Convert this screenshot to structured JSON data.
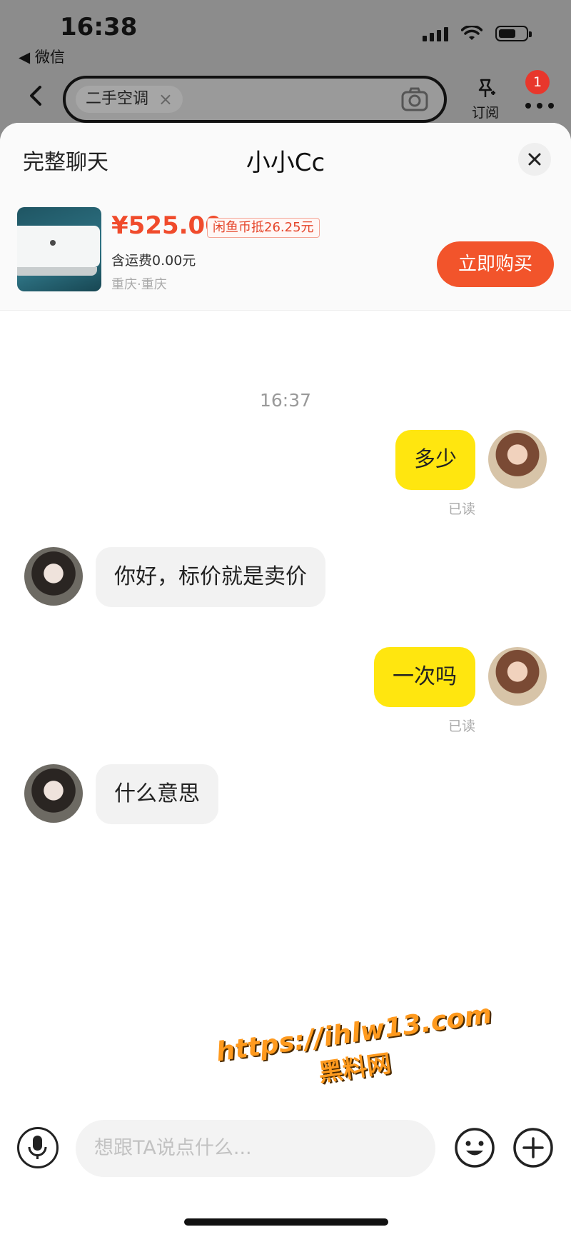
{
  "status_bar": {
    "time": "16:38",
    "back_app": "◀ 微信",
    "battery_level": 0.65
  },
  "nav": {
    "search_chip": "二手空调",
    "subscribe_label": "订阅",
    "notification_count": "1"
  },
  "sheet": {
    "full_chat_label": "完整聊天",
    "title": "小小Cc"
  },
  "product": {
    "price": "¥525.00",
    "coin_discount": "闲鱼币抵26.25元",
    "shipping": "含运费0.00元",
    "location": "重庆·重庆",
    "buy_label": "立即购买"
  },
  "chat": {
    "timestamp": "16:37",
    "messages": [
      {
        "from": "me",
        "text": "多少",
        "status": "已读"
      },
      {
        "from": "other",
        "text": "你好，标价就是卖价"
      },
      {
        "from": "me",
        "text": "一次吗",
        "status": "已读"
      },
      {
        "from": "other",
        "text": "什么意思"
      }
    ]
  },
  "input": {
    "placeholder": "想跟TA说点什么..."
  },
  "watermark": {
    "url": "https://ihlw13.com",
    "name": "黑料网"
  },
  "colors": {
    "accent": "#f2542b",
    "my_bubble": "#ffe60f",
    "price": "#f04b2c",
    "badge": "#e8372c"
  }
}
